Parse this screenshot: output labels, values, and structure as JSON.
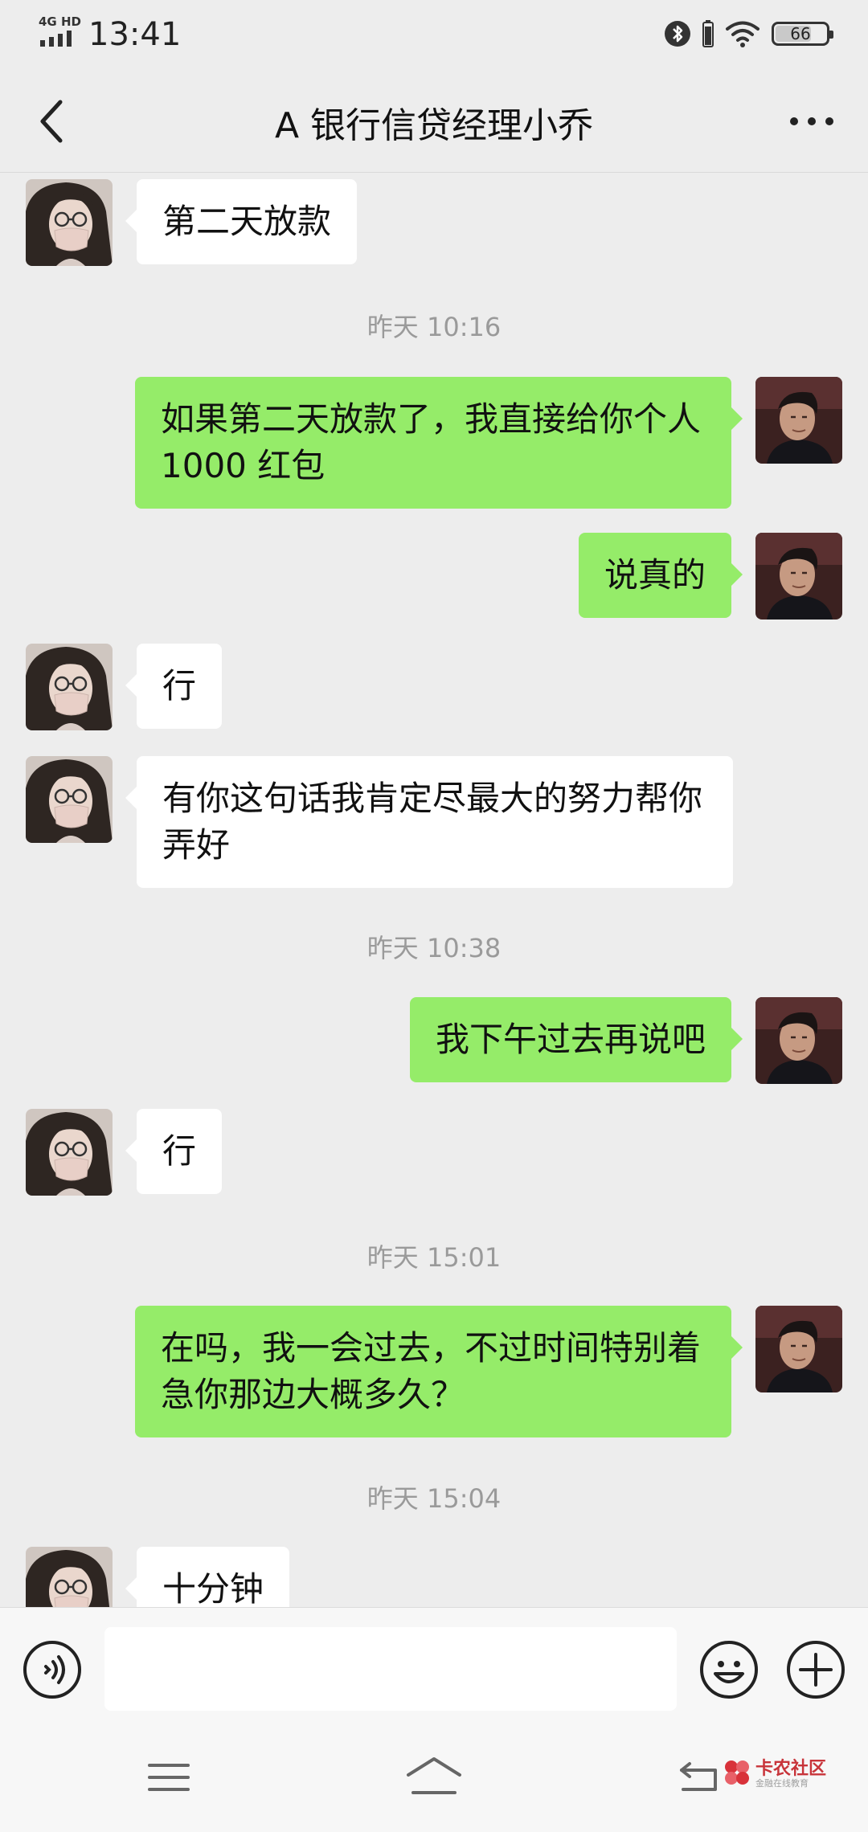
{
  "status_bar": {
    "network": "4G HD",
    "time": "13:41",
    "battery": "66",
    "battery_level": 0.66
  },
  "header": {
    "back_icon": "chevron-left-icon",
    "title": "A 银行信贷经理小乔",
    "more_icon": "more-dots-icon"
  },
  "messages": [
    {
      "type": "in",
      "text": "第二天放款"
    },
    {
      "type": "time",
      "text": "昨天 10:16"
    },
    {
      "type": "out",
      "text": "如果第二天放款了，我直接给你个人 1000 红包"
    },
    {
      "type": "out",
      "text": "说真的"
    },
    {
      "type": "in",
      "text": "行"
    },
    {
      "type": "in",
      "text": "有你这句话我肯定尽最大的努力帮你弄好"
    },
    {
      "type": "time",
      "text": "昨天 10:38"
    },
    {
      "type": "out",
      "text": "我下午过去再说吧"
    },
    {
      "type": "in",
      "text": "行"
    },
    {
      "type": "time",
      "text": "昨天 15:01"
    },
    {
      "type": "out",
      "text": "在吗，我一会过去，不过时间特别着急你那边大概多久？"
    },
    {
      "type": "time",
      "text": "昨天 15:04"
    },
    {
      "type": "in",
      "text": "十分钟"
    }
  ],
  "input_bar": {
    "voice_icon": "voice-icon",
    "input_value": "",
    "emoji_icon": "emoji-icon",
    "plus_icon": "plus-icon"
  },
  "nav_bar": {
    "menu_icon": "menu-icon",
    "home_icon": "home-icon",
    "back_icon": "back-icon"
  },
  "watermark": {
    "name": "卡农社区",
    "tagline": "金融在线教育"
  },
  "colors": {
    "background": "#ededed",
    "outgoing_bubble": "#95ec69",
    "incoming_bubble": "#ffffff",
    "timestamp": "#9a9a9a"
  }
}
